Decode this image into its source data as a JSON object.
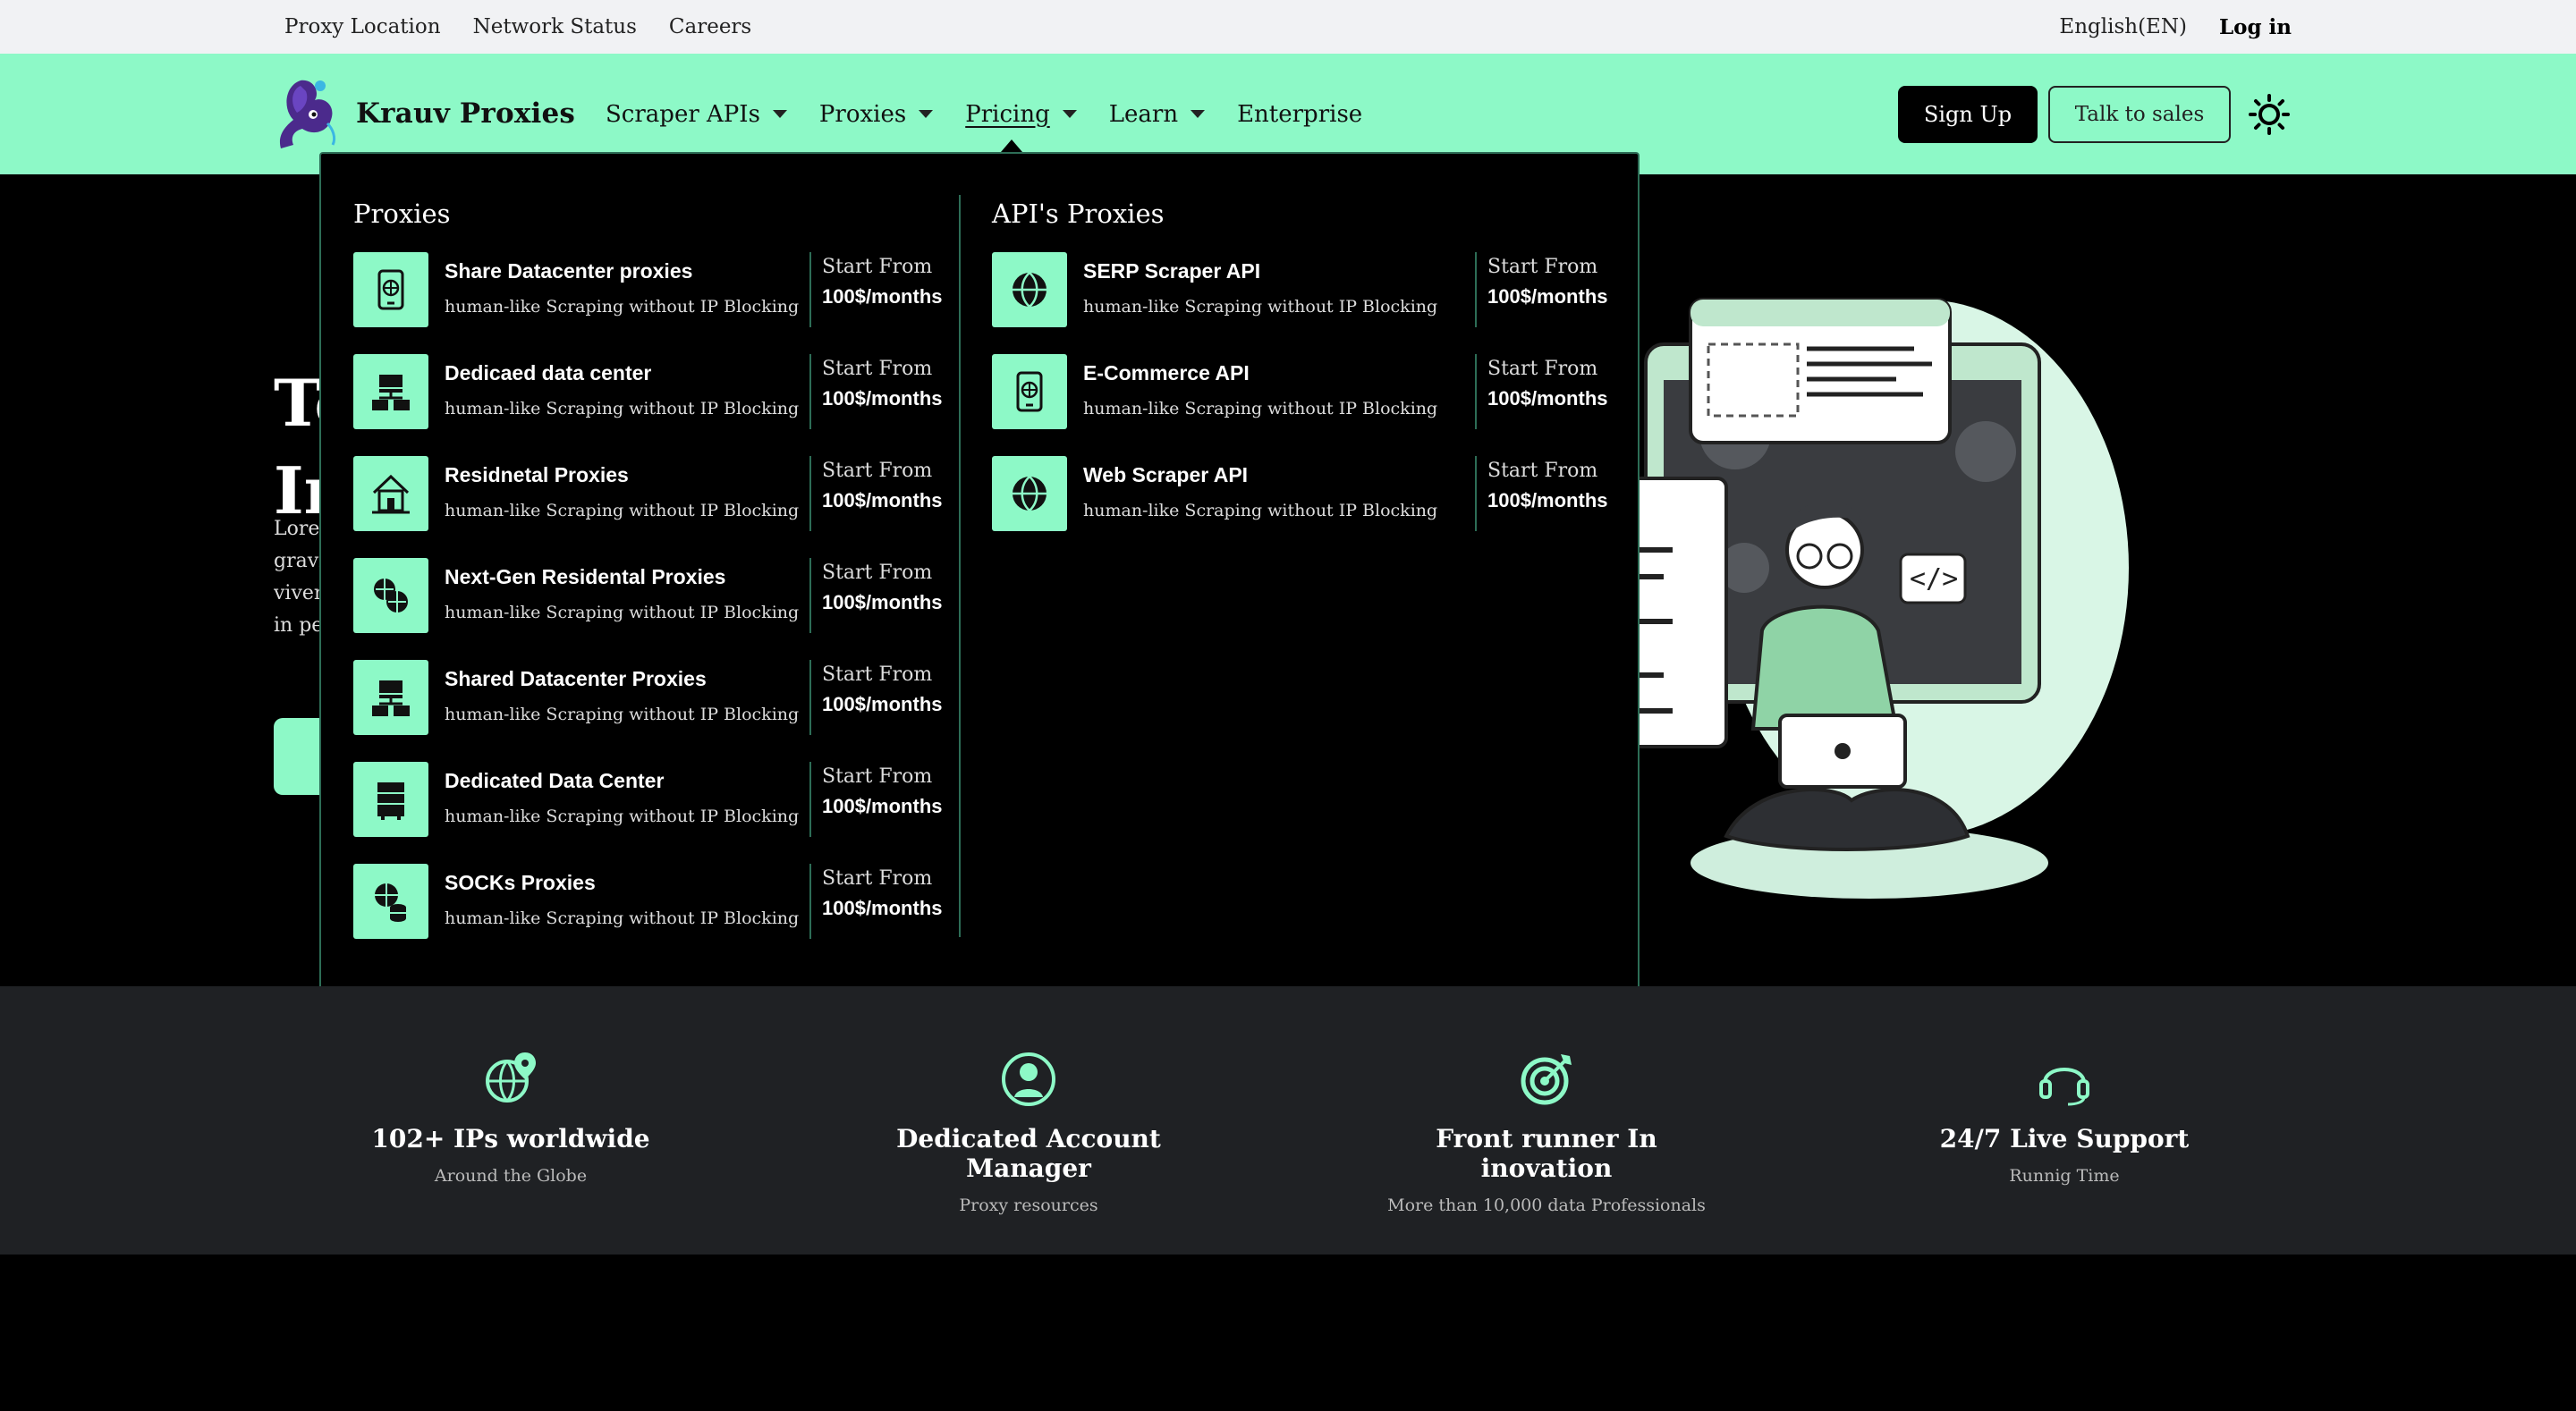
{
  "topbar": {
    "links": [
      "Proxy Location",
      "Network Status",
      "Careers"
    ],
    "language": "English(EN)",
    "login": "Log in"
  },
  "header": {
    "brand": "Krauv Proxies",
    "nav": [
      "Scraper APIs",
      "Proxies",
      "Pricing",
      "Learn",
      "Enterprise"
    ],
    "active_nav": "Pricing",
    "signup": "Sign Up",
    "sales": "Talk to sales",
    "theme_icon": "sun-icon"
  },
  "hero": {
    "title_line1": "To",
    "title_line2": "In",
    "text_lines": [
      "Lorem",
      "gravi",
      "viver",
      "in pe"
    ]
  },
  "mega": {
    "proxies_title": "Proxies",
    "apis_title": "API's Proxies",
    "proxies": [
      {
        "name": "Share Datacenter proxies",
        "desc": "human-like Scraping without IP Blocking",
        "from": "Start From",
        "price": "100$/months",
        "icon": "phone-globe-icon"
      },
      {
        "name": "Dedicaed data center",
        "desc": "human-like Scraping without IP Blocking",
        "from": "Start From",
        "price": "100$/months",
        "icon": "server-network-icon"
      },
      {
        "name": "Residnetal Proxies",
        "desc": "human-like Scraping without IP Blocking",
        "from": "Start From",
        "price": "100$/months",
        "icon": "house-icon"
      },
      {
        "name": "Next-Gen Residental Proxies",
        "desc": "human-like Scraping without IP Blocking",
        "from": "Start From",
        "price": "100$/months",
        "icon": "globes-icon"
      },
      {
        "name": "Shared Datacenter Proxies",
        "desc": "human-like Scraping without IP Blocking",
        "from": "Start From",
        "price": "100$/months",
        "icon": "server-network-icon"
      },
      {
        "name": "Dedicated Data Center",
        "desc": "human-like Scraping without IP Blocking",
        "from": "Start From",
        "price": "100$/months",
        "icon": "server-rack-icon"
      },
      {
        "name": "SOCKs Proxies",
        "desc": "human-like Scraping without IP Blocking",
        "from": "Start From",
        "price": "100$/months",
        "icon": "globe-database-icon"
      }
    ],
    "apis": [
      {
        "name": "SERP Scraper API",
        "desc": "human-like Scraping without IP Blocking",
        "from": "Start From",
        "price": "100$/months",
        "icon": "globe-icon"
      },
      {
        "name": "E-Commerce API",
        "desc": "human-like Scraping without IP Blocking",
        "from": "Start From",
        "price": "100$/months",
        "icon": "phone-globe-icon"
      },
      {
        "name": "Web Scraper API",
        "desc": "human-like Scraping without IP Blocking",
        "from": "Start From",
        "price": "100$/months",
        "icon": "globe-icon"
      }
    ]
  },
  "features": [
    {
      "title": "102+ IPs worldwide",
      "sub": "Around the Globe",
      "icon": "globe-pin-icon"
    },
    {
      "title": "Dedicated Account Manager",
      "sub": "Proxy resources",
      "icon": "user-icon"
    },
    {
      "title": "Front runner In inovation",
      "sub": "More than 10,000 data Professionals",
      "icon": "target-icon"
    },
    {
      "title": "24/7 Live Support",
      "sub": "Runnig Time",
      "icon": "headset-icon"
    }
  ],
  "colors": {
    "accent": "#8df9c7",
    "dark": "#000000",
    "strip": "#1f2124",
    "topbar": "#f1f2f4"
  }
}
